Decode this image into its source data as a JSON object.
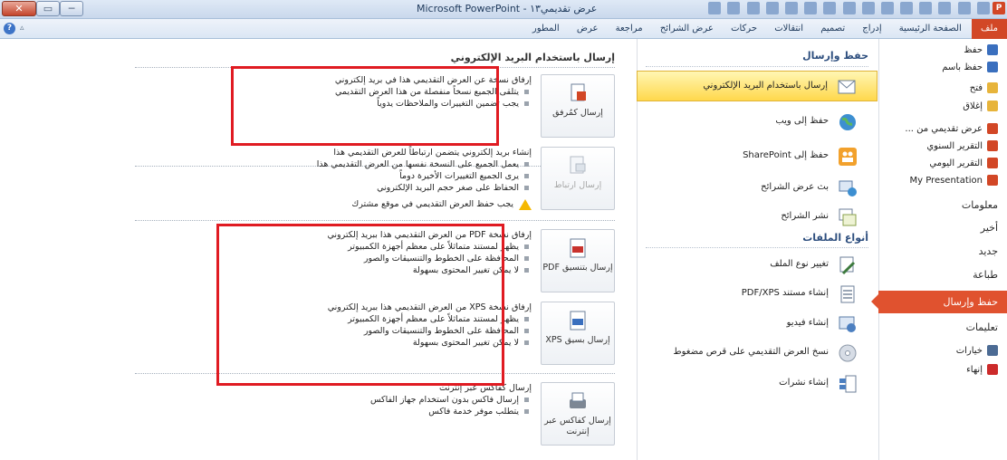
{
  "window": {
    "title": "Microsoft PowerPoint - عرض تقديمي١٣",
    "controls": {
      "close": "✕",
      "maximize": "▭",
      "minimize": "─"
    },
    "qat_app_icon": "P"
  },
  "ribbon": {
    "tabs": [
      "ملف",
      "الصفحة الرئيسية",
      "إدراج",
      "تصميم",
      "انتقالات",
      "حركات",
      "عرض الشرائح",
      "مراجعة",
      "عرض",
      "المطور"
    ],
    "help_icon": "?",
    "minimize_icon": "▵"
  },
  "nav": {
    "items": [
      {
        "label": "حفظ",
        "icon": "save-icon",
        "color": "#3a6fbe"
      },
      {
        "label": "حفظ باسم",
        "icon": "save-as-icon",
        "color": "#3a6fbe"
      },
      {
        "label": "فتح",
        "icon": "open-folder-icon",
        "color": "#e7b43b"
      },
      {
        "label": "إغلاق",
        "icon": "close-folder-icon",
        "color": "#e7b43b"
      },
      {
        "label": "عرض تقديمي من ...",
        "icon": "ppt-file-icon",
        "color": "#d24726"
      },
      {
        "label": "التقرير السنوي",
        "icon": "ppt-file-icon",
        "color": "#d24726"
      },
      {
        "label": "التقرير اليومي",
        "icon": "ppt-file-icon",
        "color": "#d24726"
      },
      {
        "label": "My Presentation",
        "icon": "ppt-file-icon",
        "color": "#d24726"
      }
    ],
    "sections": [
      "معلومات",
      "أخير",
      "جديد",
      "طباعة",
      "حفظ وإرسال",
      "تعليمات"
    ],
    "footer_items": [
      {
        "label": "خيارات",
        "icon": "options-icon",
        "color": "#4c6b94"
      },
      {
        "label": "إنهاء",
        "icon": "exit-icon",
        "color": "#cc2b2b"
      }
    ]
  },
  "middle": {
    "save_send_heading": "حفظ وإرسال",
    "save_send_items": [
      {
        "label": "إرسال باستخدام البريد الإلكتروني",
        "icon": "email-icon",
        "selected": true
      },
      {
        "label": "حفظ إلى ويب",
        "icon": "globe-icon",
        "selected": false
      },
      {
        "label": "حفظ إلى SharePoint",
        "icon": "sharepoint-icon",
        "selected": false
      },
      {
        "label": "بث عرض الشرائح",
        "icon": "broadcast-icon",
        "selected": false
      },
      {
        "label": "نشر الشرائح",
        "icon": "publish-slides-icon",
        "selected": false
      }
    ],
    "file_types_heading": "أنواع الملفات",
    "file_types_items": [
      {
        "label": "تغيير نوع الملف",
        "icon": "change-type-icon"
      },
      {
        "label": "إنشاء مستند PDF/XPS",
        "icon": "pdf-xps-icon"
      },
      {
        "label": "إنشاء فيديو",
        "icon": "video-icon"
      },
      {
        "label": "نسخ العرض التقديمي على قرص مضغوط",
        "icon": "cd-icon"
      },
      {
        "label": "إنشاء نشرات",
        "icon": "handouts-icon"
      }
    ]
  },
  "detail": {
    "heading": "إرسال باستخدام البريد الإلكتروني",
    "options": [
      {
        "button": "إرسال كمُرفق",
        "icon": "attachment-icon",
        "description": "إرفاق نسخة عن العرض التقديمي هذا في بريد إلكتروني",
        "bullets": [
          "يتلقى الجميع نسخاً منفصلة من هذا العرض التقديمي",
          "يجب تضمين التغييرات والملاحظات يدوياً"
        ],
        "warning": "",
        "highlighted": true,
        "disabled": false
      },
      {
        "button": "إرسال ارتباط",
        "icon": "link-icon",
        "description": "إنشاء بريد إلكتروني يتضمن ارتباطاً للعرض التقديمي هذا",
        "bullets": [
          "يعمل الجميع على النسخة نفسها من العرض التقديمي هذا",
          "يرى الجميع التغييرات الأخيرة دوماً",
          "الحفاظ على صغر حجم البريد الإلكتروني"
        ],
        "warning": "يجب حفظ العرض التقديمي في موقع مشترك",
        "highlighted": false,
        "disabled": true
      },
      {
        "button": "إرسال بتنسيق PDF",
        "icon": "pdf-icon",
        "description": "إرفاق نسخة PDF من العرض التقديمي هذا ببريد إلكتروني",
        "bullets": [
          "يظهر لمستند متماثلاً على معظم أجهزة الكمبيوتر",
          "المحافظة على الخطوط والتنسيقات والصور",
          "لا يمكن تغيير المحتوى بسهولة"
        ],
        "warning": "",
        "highlighted": true,
        "disabled": false
      },
      {
        "button": "إرسال بسيق XPS",
        "icon": "xps-icon",
        "description": "إرفاق نسخة XPS من العرض التقديمي هذا ببريد إلكتروني",
        "bullets": [
          "يظهر لمستند متماثلاً على معظم أجهزة الكمبيوتر",
          "المحافظة على الخطوط والتنسيقات والصور",
          "لا يمكن تغيير المحتوى بسهولة"
        ],
        "warning": "",
        "highlighted": true,
        "disabled": false
      },
      {
        "button": "إرسال كفاكس عبر إنترنت",
        "icon": "fax-icon",
        "description": "إرسال كفاكس عبر إنترنت",
        "bullets": [
          "إرسال فاكس بدون استخدام جهاز الفاكس",
          "يتطلب موفر خدمة فاكس"
        ],
        "warning": "",
        "highlighted": false,
        "disabled": false
      }
    ]
  },
  "colors": {
    "accent": "#e0522f",
    "highlight": "#e01b22",
    "selection": "#ffd84c"
  }
}
